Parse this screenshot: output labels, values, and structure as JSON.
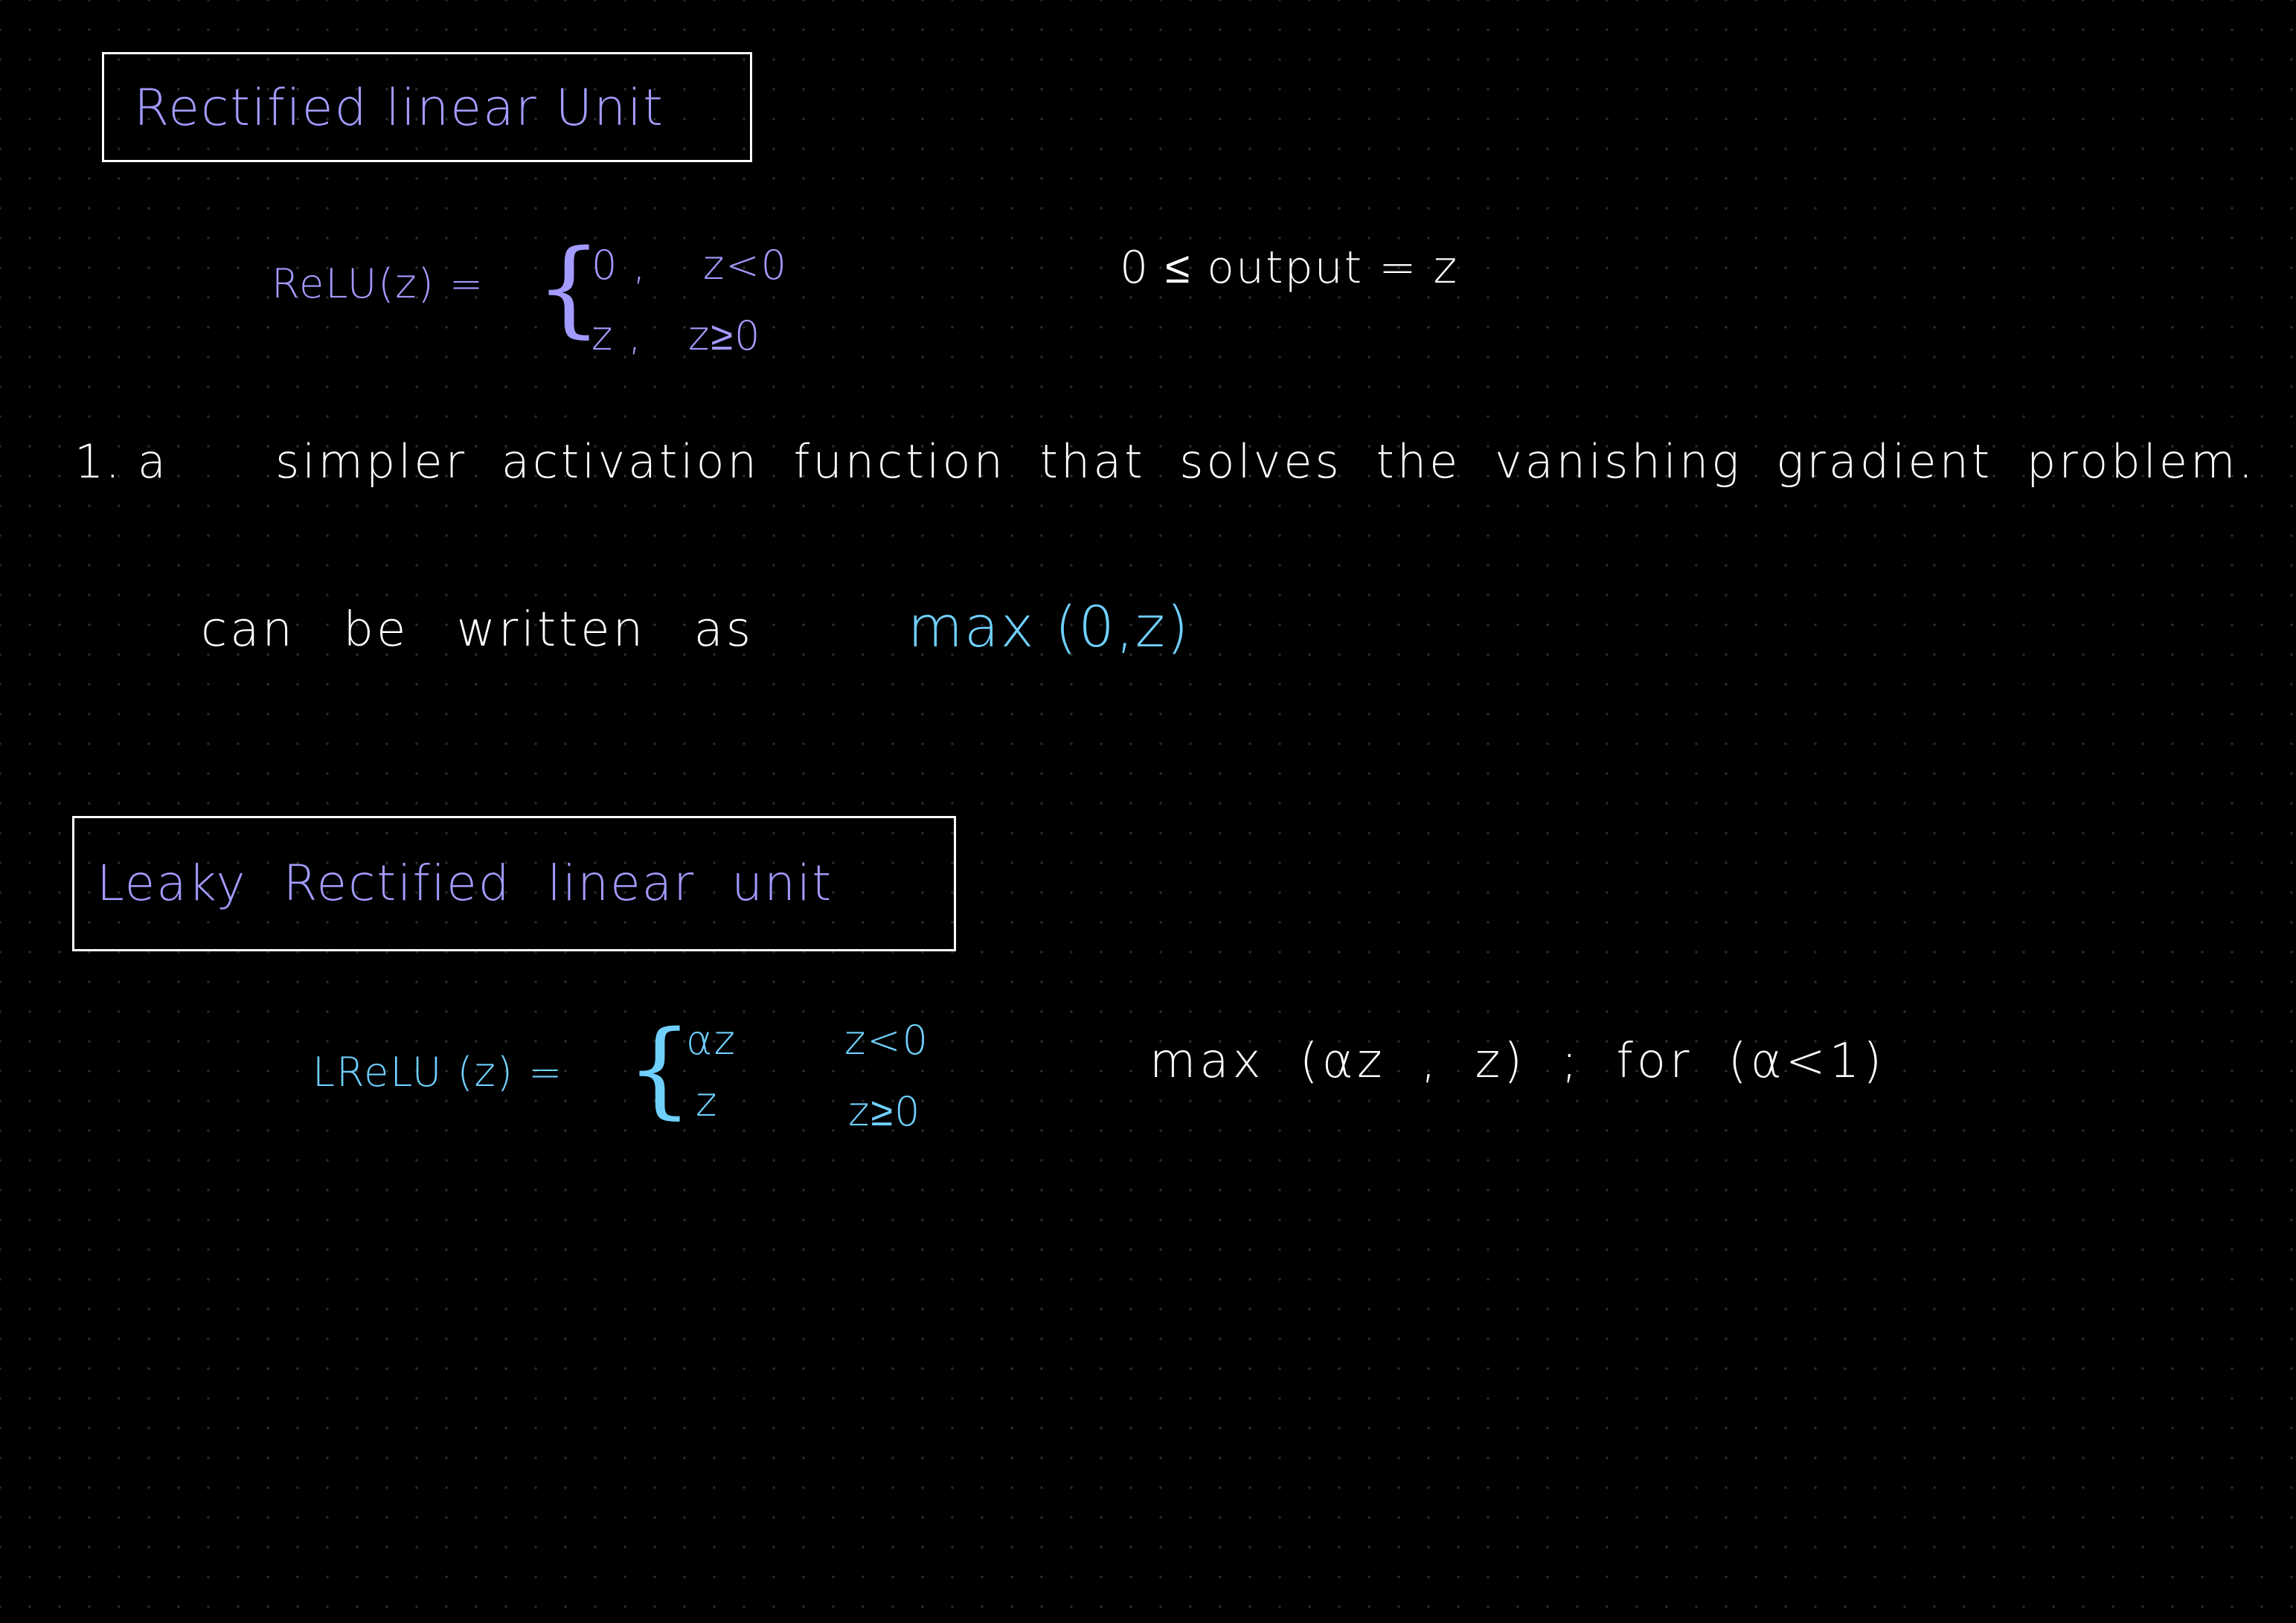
{
  "colors": {
    "background": "#000000",
    "heading": "#a39bff",
    "formula": "#6fd0ff",
    "text": "#ffffff",
    "box_border": "#ffffff"
  },
  "relu_section": {
    "heading": "Rectified linear Unit",
    "formula_lhs": "ReLU(z) =",
    "case1_value": "0 ,",
    "case1_cond": "z<0",
    "case2_value": "z ,",
    "case2_cond": "z≥0",
    "range_note": "0 ≤ output = z"
  },
  "notes": {
    "line1_number": "1. a",
    "line1_text": "simpler activation function that solves the vanishing gradient problem.",
    "line2_text": "can be written as",
    "line2_formula": "max (0,z)"
  },
  "lrelu_section": {
    "heading": "Leaky Rectified linear unit",
    "formula_lhs": "LReLU (z) =",
    "case1_value": "αz",
    "case1_cond": "z<0",
    "case2_value": "z",
    "case2_cond": "z≥0",
    "max_note": "max (αz , z) ; for (α<1)"
  }
}
